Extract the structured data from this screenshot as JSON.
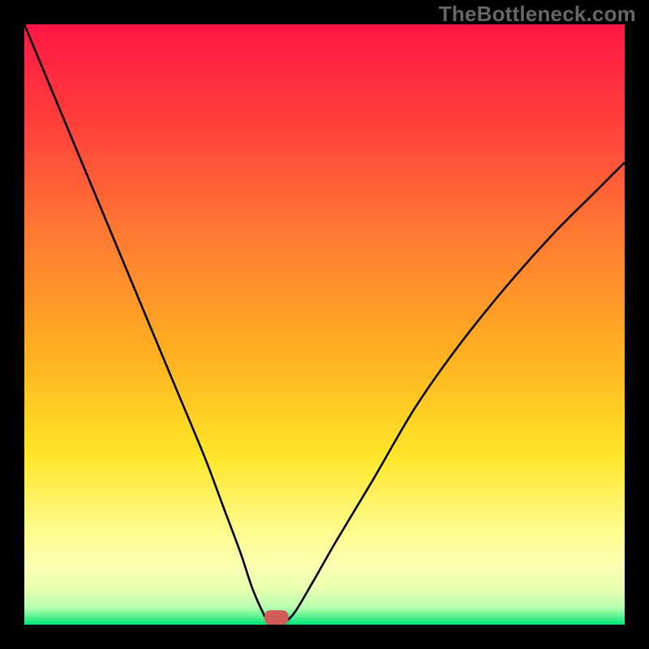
{
  "watermark": "TheBottleneck.com",
  "chart_data": {
    "type": "line",
    "title": "",
    "xlabel": "",
    "ylabel": "",
    "xlim": [
      0,
      100
    ],
    "ylim": [
      0,
      100
    ],
    "grid": false,
    "legend": null,
    "gradient_stops": [
      {
        "offset": 0,
        "color": "#ff1744"
      },
      {
        "offset": 0.15,
        "color": "#ff3b3b"
      },
      {
        "offset": 0.35,
        "color": "#ff7a33"
      },
      {
        "offset": 0.55,
        "color": "#ffb020"
      },
      {
        "offset": 0.72,
        "color": "#ffe629"
      },
      {
        "offset": 0.84,
        "color": "#fffb8a"
      },
      {
        "offset": 0.9,
        "color": "#fbffb0"
      },
      {
        "offset": 0.94,
        "color": "#e9ffb0"
      },
      {
        "offset": 0.972,
        "color": "#b6ffb0"
      },
      {
        "offset": 1.0,
        "color": "#00e676"
      }
    ],
    "series": [
      {
        "name": "left_curve",
        "x": [
          0,
          5,
          10,
          15,
          20,
          25,
          30,
          33,
          36,
          38,
          40,
          41
        ],
        "values": [
          100,
          88,
          76,
          64,
          52,
          40,
          28,
          20,
          12,
          6,
          1.5,
          0
        ]
      },
      {
        "name": "right_curve",
        "x": [
          43,
          45,
          48,
          52,
          58,
          65,
          72,
          80,
          88,
          95,
          100
        ],
        "values": [
          0,
          2,
          7,
          14,
          24,
          36,
          46,
          56,
          65,
          72,
          77
        ]
      }
    ],
    "marker": {
      "name": "bottom_marker",
      "x_start": 40,
      "x_end": 44,
      "y": 0,
      "color": "#d15b5b",
      "thickness": 2.4
    }
  }
}
